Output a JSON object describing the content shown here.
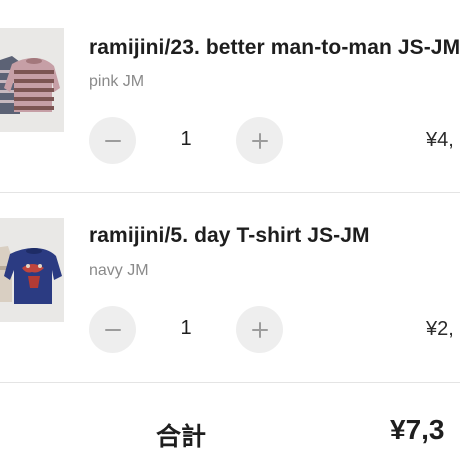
{
  "cart": {
    "items": [
      {
        "name": "ramijini/23. better man-to-man JS-JM",
        "variant": "pink JM",
        "quantity": "1",
        "decrease_icon": "minus-icon",
        "increase_icon": "plus-icon",
        "price": "¥4,",
        "thumbnail_icon": "striped-sweater-image"
      },
      {
        "name": "ramijini/5. day T-shirt JS-JM",
        "variant": "navy JM",
        "quantity": "1",
        "decrease_icon": "minus-icon",
        "increase_icon": "plus-icon",
        "price": "¥2,",
        "thumbnail_icon": "navy-tshirt-image"
      }
    ]
  },
  "summary": {
    "total_label": "合計",
    "total_value": "¥7,3"
  },
  "colors": {
    "button_bg": "#eeeeee",
    "button_icon": "#9c9c9c",
    "divider": "#e4e4e4",
    "variant_text": "#8a8a8a",
    "text": "#1e1e1e"
  }
}
